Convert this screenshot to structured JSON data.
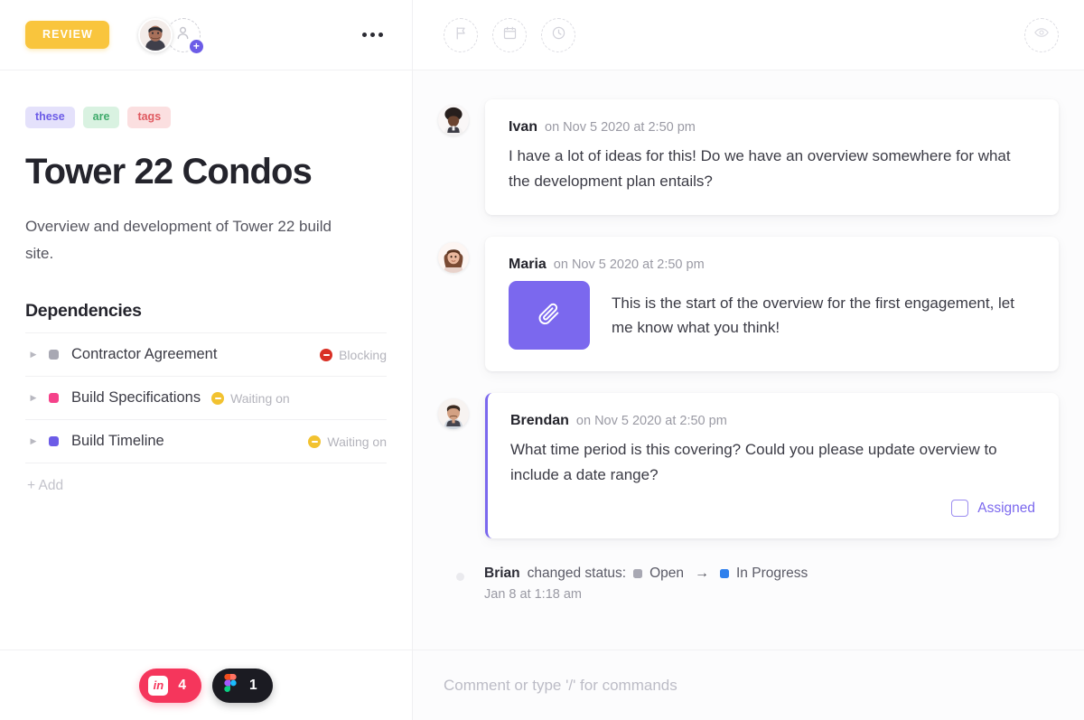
{
  "task": {
    "status_badge": "REVIEW",
    "status_badge_color": "#f9c53d",
    "tags": [
      {
        "label": "these",
        "color": "#6c5ce7"
      },
      {
        "label": "are",
        "color": "#3fab6b"
      },
      {
        "label": "tags",
        "color": "#e05a61"
      }
    ],
    "title": "Tower 22 Condos",
    "description": "Overview and development of Tower 22 build site.",
    "more_menu": "...",
    "add_assignee": "+"
  },
  "dependencies": {
    "heading": "Dependencies",
    "add_label": "+ Add",
    "rows": [
      {
        "name": "Contractor Agreement",
        "square_color": "#a8a8b3",
        "status": "Blocking",
        "status_color": "#d93025"
      },
      {
        "name": "Build Specifications",
        "square_color": "#f5428a",
        "status": "Waiting on",
        "status_color": "#f2c230"
      },
      {
        "name": "Build Timeline",
        "square_color": "#6c5ce7",
        "status": "Waiting on",
        "status_color": "#f2c230"
      }
    ]
  },
  "toolbar": {
    "flag": "flag-icon",
    "calendar": "calendar-icon",
    "clock": "clock-icon",
    "watch": "eye-icon"
  },
  "comments": [
    {
      "author": "Ivan",
      "time": "on Nov 5 2020 at 2:50 pm",
      "text": "I have a lot of ideas for this! Do we have an overview somewhere for what the development plan entails?",
      "avatar": "ivan-avatar",
      "has_attachment": false,
      "highlighted": false
    },
    {
      "author": "Maria",
      "time": "on Nov 5 2020 at 2:50 pm",
      "text": "This is the start of the overview for the first engagement, let me know what you think!",
      "avatar": "maria-avatar",
      "has_attachment": true,
      "attachment_icon": "paperclip-icon",
      "attachment_color": "#7b68ee",
      "highlighted": false
    },
    {
      "author": "Brendan",
      "time": "on Nov 5 2020 at 2:50 pm",
      "text": "What time period is this covering? Could you please update overview to include a date range?",
      "avatar": "brendan-avatar",
      "has_attachment": false,
      "highlighted": true,
      "assigned_label": "Assigned",
      "assigned_checked": false
    }
  ],
  "activity": {
    "author": "Brian",
    "action": "changed status:",
    "from_status": "Open",
    "from_color": "#a8a8b3",
    "arrow": "→",
    "to_status": "In Progress",
    "to_color": "#2f80ed",
    "time": "Jan 8 at 1:18 am"
  },
  "footer_badges": [
    {
      "icon": "linkedin-icon",
      "count": "4",
      "bg": "#f5365c"
    },
    {
      "icon": "figma-icon",
      "count": "1",
      "bg": "#1b1b22"
    }
  ],
  "composer": {
    "placeholder": "Comment or type '/' for commands",
    "value": ""
  }
}
